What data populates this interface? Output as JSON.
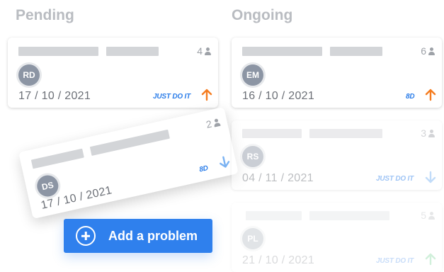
{
  "columns": {
    "pending": {
      "title": "Pending"
    },
    "ongoing": {
      "title": "Ongoing"
    }
  },
  "cards": [
    {
      "id": "p1",
      "count": "4",
      "avatar": "RD",
      "date": "17 / 10 / 2021",
      "tag": "JUST DO IT",
      "priority": "up",
      "arrow_color": "#f57c1f"
    },
    {
      "id": "p2",
      "count": "2",
      "avatar": "DS",
      "date": "17 / 10 / 2021",
      "tag": "8D",
      "priority": "down",
      "arrow_color": "#7ab2f2"
    },
    {
      "id": "o1",
      "count": "6",
      "avatar": "EM",
      "date": "16 / 10 / 2021",
      "tag": "8D",
      "priority": "up",
      "arrow_color": "#f57c1f"
    },
    {
      "id": "o2",
      "count": "3",
      "avatar": "RS",
      "date": "04 / 11 / 2021",
      "tag": "JUST DO IT",
      "priority": "down",
      "arrow_color": "#7ab2f2"
    },
    {
      "id": "o3",
      "count": "5",
      "avatar": "PL",
      "date": "21 / 10 / 2021",
      "tag": "JUST DO IT",
      "priority": "up",
      "arrow_color": "#4cc472"
    }
  ],
  "add_button": {
    "label": "Add a problem"
  },
  "colors": {
    "accent": "#2f80ed",
    "priority_high": "#f57c1f",
    "priority_low": "#7ab2f2",
    "priority_ok": "#4cc472"
  }
}
